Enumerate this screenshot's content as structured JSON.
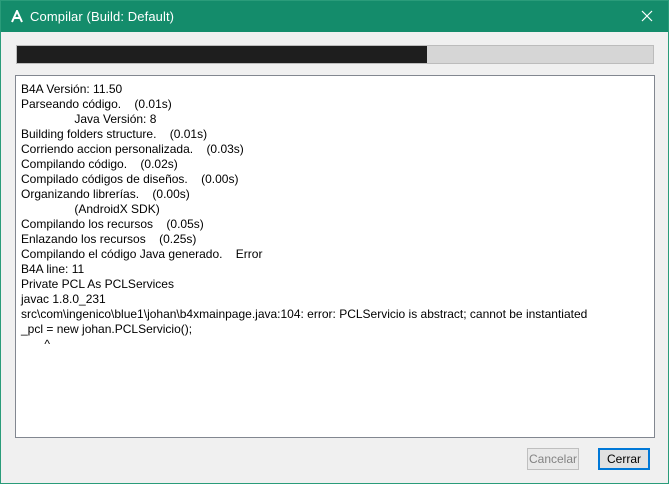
{
  "window": {
    "title": "Compilar (Build: Default)",
    "accent_color": "#148c6b"
  },
  "progress": {
    "value_percent": 64.5
  },
  "log": {
    "lines": [
      "B4A Versión: 11.50",
      "Parseando código.    (0.01s)",
      "                Java Versión: 8",
      "Building folders structure.    (0.01s)",
      "Corriendo accion personalizada.    (0.03s)",
      "Compilando código.    (0.02s)",
      "Compilado códigos de diseños.    (0.00s)",
      "Organizando librerías.    (0.00s)",
      "                (AndroidX SDK)",
      "Compilando los recursos    (0.05s)",
      "Enlazando los recursos    (0.25s)",
      "Compilando el código Java generado.    Error",
      "B4A line: 11",
      "Private PCL As PCLServices",
      "javac 1.8.0_231",
      "src\\com\\ingenico\\blue1\\johan\\b4xmainpage.java:104: error: PCLServicio is abstract; cannot be instantiated",
      "_pcl = new johan.PCLServicio();",
      "       ^"
    ]
  },
  "buttons": {
    "cancel_label": "Cancelar",
    "close_label": "Cerrar"
  },
  "icons": {
    "app": "b4a-logo-icon",
    "close": "close-icon"
  }
}
